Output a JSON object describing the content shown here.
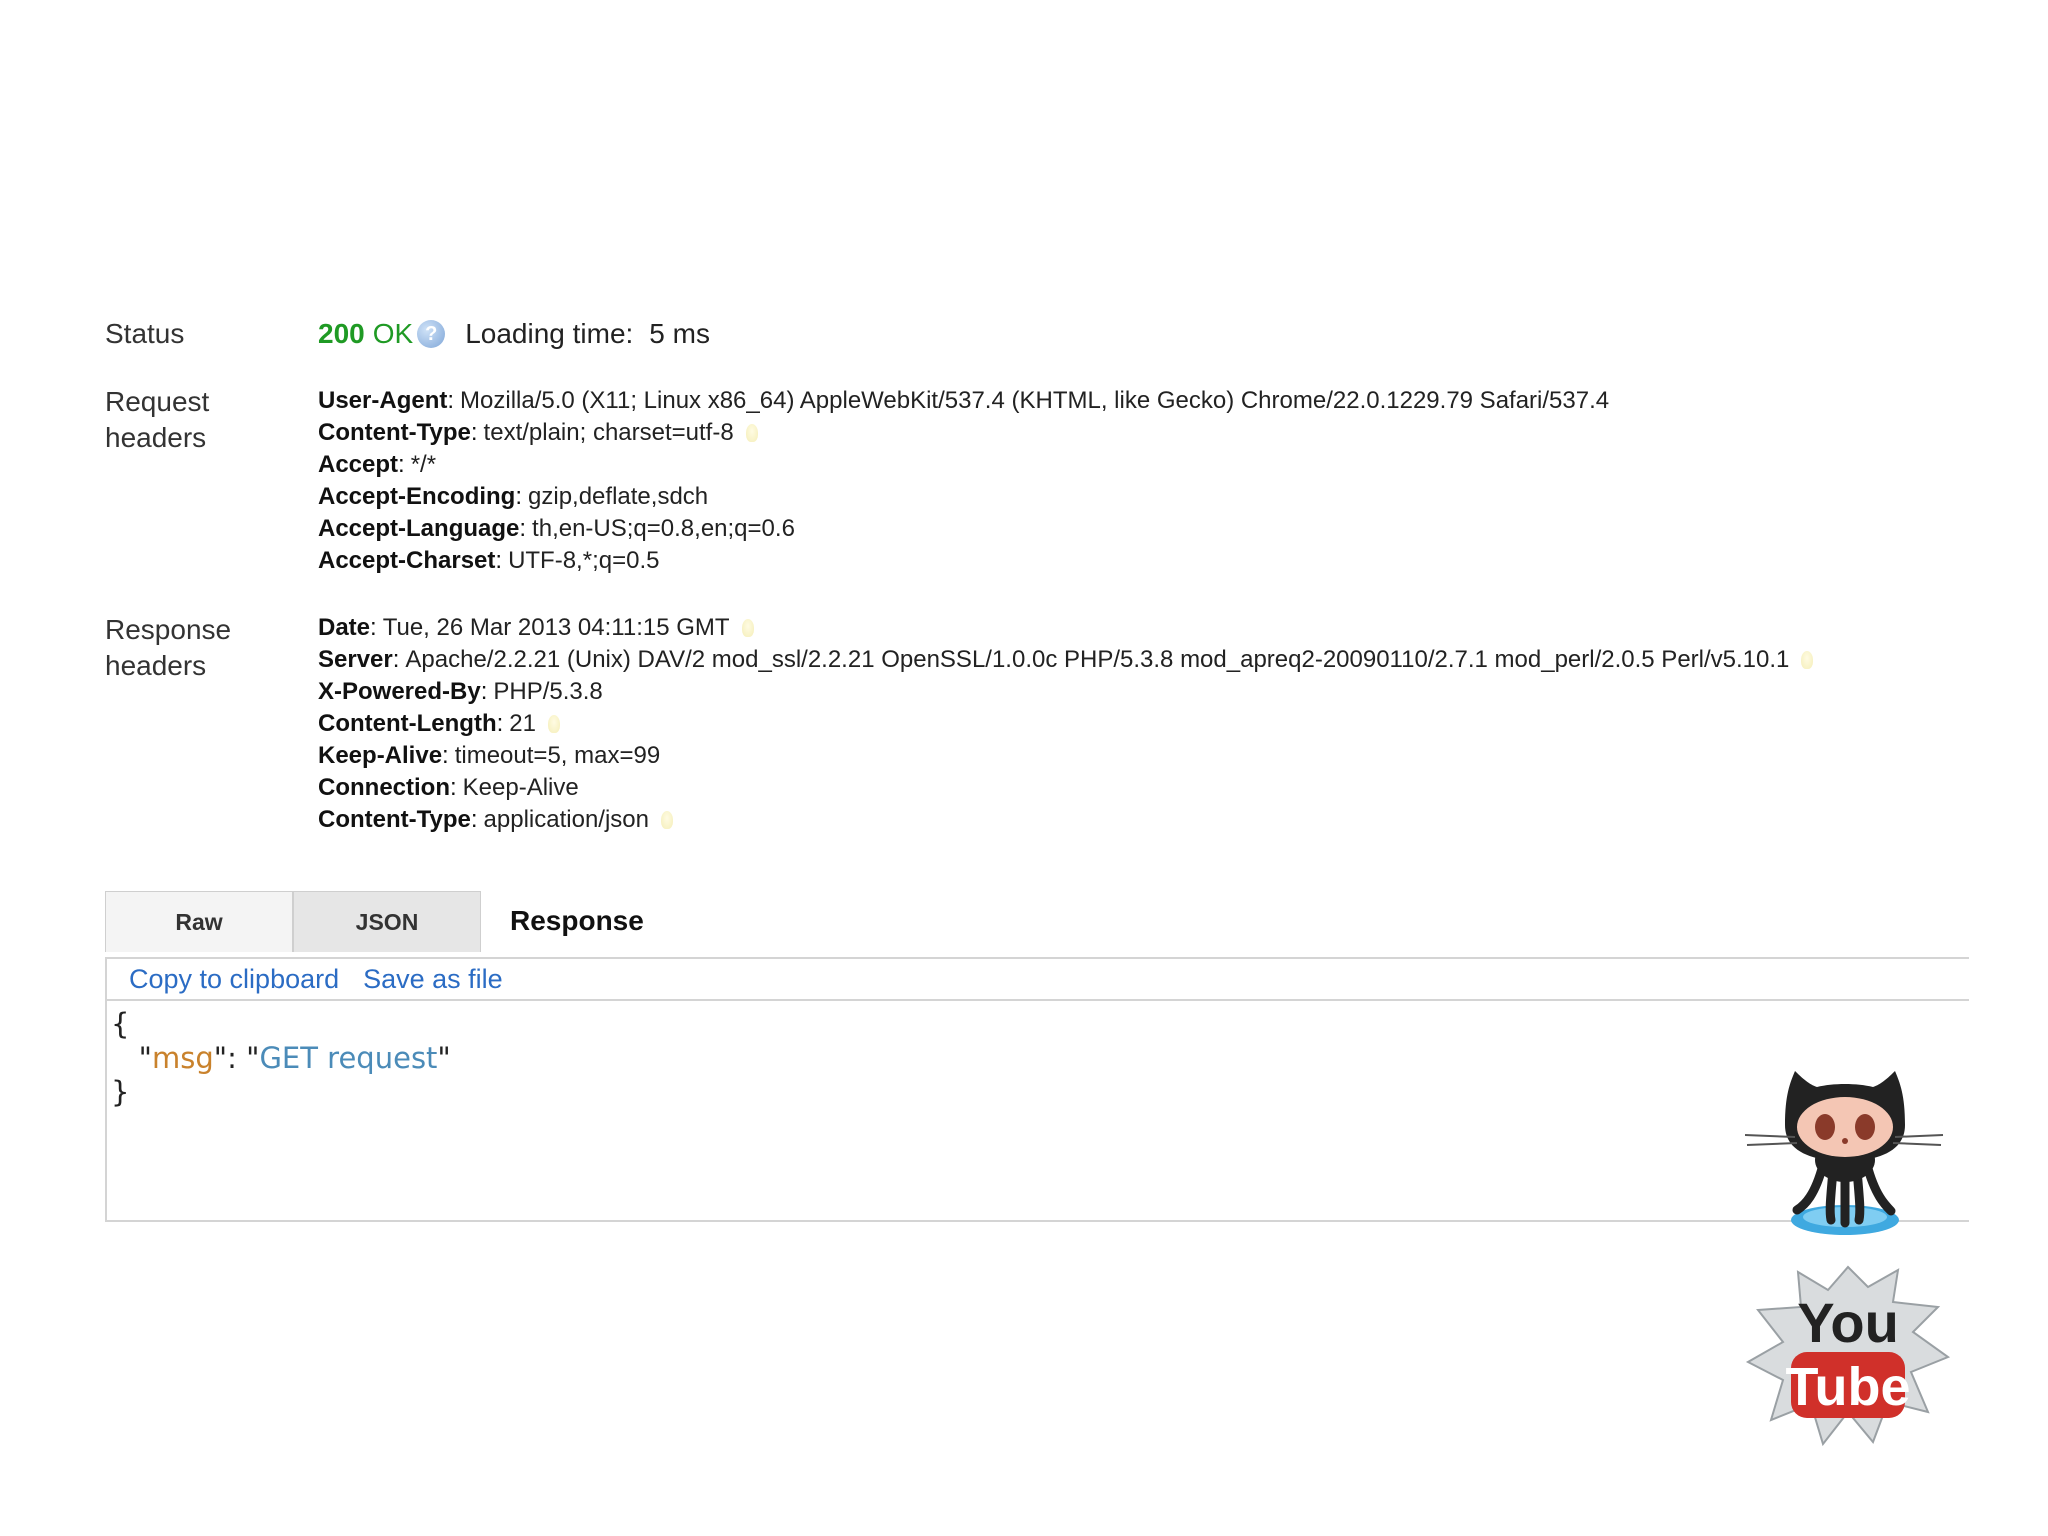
{
  "status": {
    "label": "Status",
    "code": "200",
    "text": "OK",
    "help_icon": "question-icon",
    "loading_label": "Loading time:",
    "loading_value": "5 ms"
  },
  "request_headers": {
    "label_line1": "Request",
    "label_line2": "headers",
    "items": [
      {
        "name": "User-Agent",
        "value": "Mozilla/5.0 (X11; Linux x86_64) AppleWebKit/537.4 (KHTML, like Gecko) Chrome/22.0.1229.79 Safari/537.4"
      },
      {
        "name": "Content-Type",
        "value": "text/plain; charset=utf-8"
      },
      {
        "name": "Accept",
        "value": "*/*"
      },
      {
        "name": "Accept-Encoding",
        "value": "gzip,deflate,sdch"
      },
      {
        "name": "Accept-Language",
        "value": "th,en-US;q=0.8,en;q=0.6"
      },
      {
        "name": "Accept-Charset",
        "value": "UTF-8,*;q=0.5"
      }
    ]
  },
  "response_headers": {
    "label_line1": "Response",
    "label_line2": "headers",
    "items": [
      {
        "name": "Date",
        "value": "Tue, 26 Mar 2013 04:11:15 GMT"
      },
      {
        "name": "Server",
        "value": "Apache/2.2.21 (Unix) DAV/2 mod_ssl/2.2.21 OpenSSL/1.0.0c PHP/5.3.8 mod_apreq2-20090110/2.7.1 mod_perl/2.0.5 Perl/v5.10.1"
      },
      {
        "name": "X-Powered-By",
        "value": "PHP/5.3.8"
      },
      {
        "name": "Content-Length",
        "value": "21"
      },
      {
        "name": "Keep-Alive",
        "value": "timeout=5, max=99"
      },
      {
        "name": "Connection",
        "value": "Keep-Alive"
      },
      {
        "name": "Content-Type",
        "value": "application/json"
      }
    ]
  },
  "response": {
    "tabs": [
      "Raw",
      "JSON"
    ],
    "active_tab": "JSON",
    "title": "Response",
    "actions": [
      "Copy to clipboard",
      "Save as file"
    ],
    "json_open": "{",
    "json_key": "msg",
    "json_value": "GET request",
    "json_close": "}"
  },
  "icons": {
    "octocat": "github-octocat-icon",
    "youtube": "youtube-logo-icon",
    "youtube_text_top": "You",
    "youtube_text_bottom": "Tube"
  },
  "colors": {
    "status_green": "#1f9a24",
    "link_blue": "#2b6cc4",
    "json_key": "#c9822c",
    "json_string": "#4b8bb8"
  }
}
